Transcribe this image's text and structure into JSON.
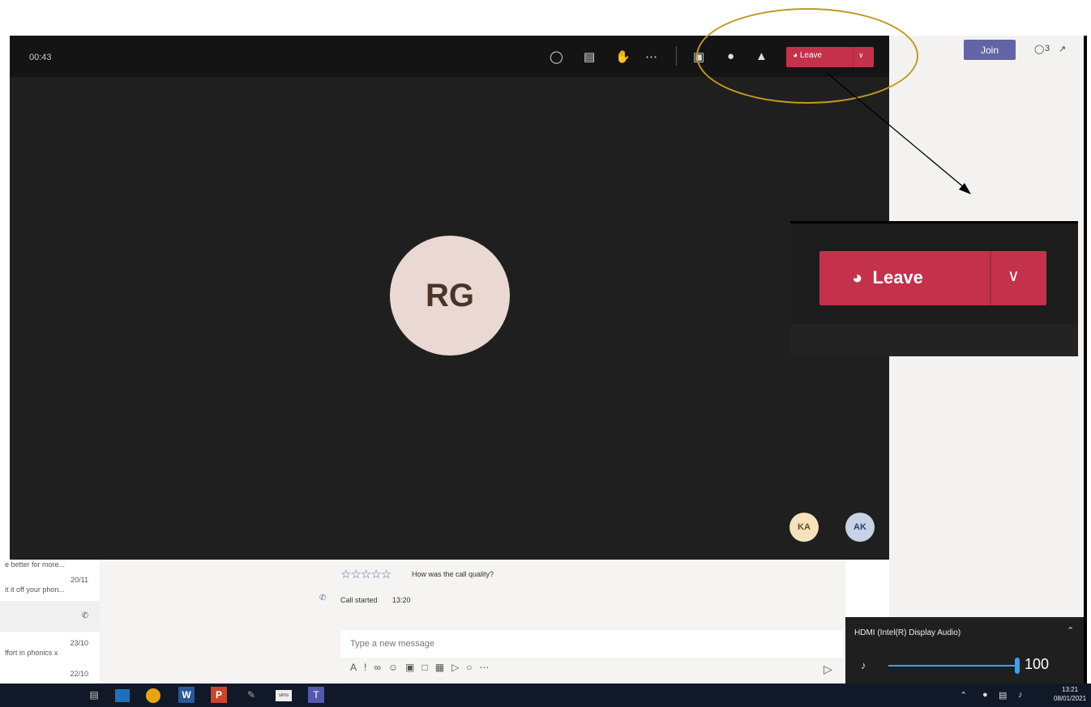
{
  "call": {
    "timer": "00:43",
    "leave_label": "Leave",
    "avatar_initials": "RG",
    "participants": [
      "KA",
      "AK"
    ]
  },
  "zoom": {
    "leave_label": "Leave"
  },
  "app": {
    "join_label": "Join",
    "participant_count": "3"
  },
  "chat": {
    "items": [
      {
        "snippet": "e better for more...",
        "date": ""
      },
      {
        "snippet": "it it off your phon...",
        "date": "20/11"
      },
      {
        "snippet": "ffort in phonics x",
        "date": "23/10"
      },
      {
        "snippet": "",
        "date": "22/10"
      }
    ]
  },
  "conversation": {
    "quality_prompt": "How was the call quality?",
    "call_started_label": "Call started",
    "call_started_time": "13:20",
    "message_placeholder": "Type a new message"
  },
  "volume": {
    "device": "HDMI  (Intel(R) Display Audio)",
    "level": "100"
  },
  "taskbar": {
    "time": "13:21",
    "date": "08/01/2021"
  },
  "colors": {
    "leave_red": "#c4314b",
    "teams_purple": "#6264a7",
    "annotation_gold": "#c09a20"
  }
}
